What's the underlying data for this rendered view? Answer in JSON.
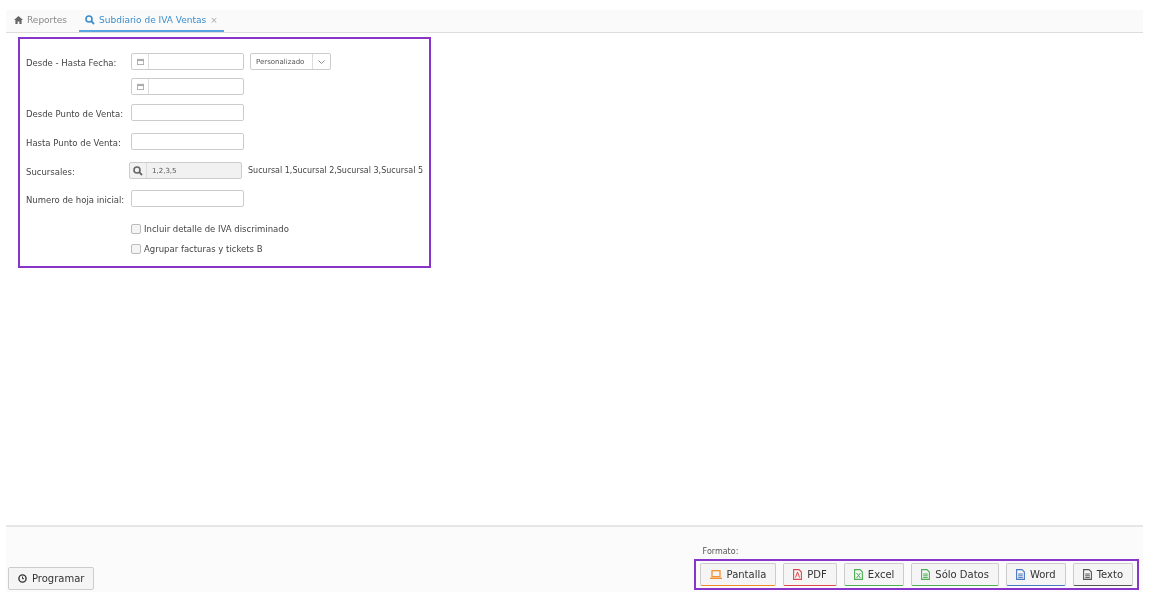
{
  "tabs": [
    {
      "label": "Reportes",
      "kind": "home",
      "selected": false
    },
    {
      "label": "Subdiario de IVA Ventas",
      "kind": "search",
      "selected": true,
      "close": "×"
    }
  ],
  "form": {
    "fields": [
      {
        "kind": "daterange",
        "label": "Desde - Hasta Fecha:",
        "period": "Personalizado"
      },
      {
        "kind": "text",
        "label": "Desde Punto de Venta:"
      },
      {
        "kind": "text",
        "label": "Hasta Punto de Venta:"
      },
      {
        "kind": "lookup",
        "label": "Sucursales:",
        "value": "1,2,3,5",
        "description": "Sucursal 1,Sucursal 2,Sucursal 3,Sucursal 5"
      },
      {
        "kind": "text",
        "label": "Numero de hoja inicial:"
      },
      {
        "kind": "checkbox",
        "label": "Incluir detalle de IVA discriminado",
        "checked": false
      },
      {
        "kind": "checkbox",
        "label": "Agrupar facturas y tickets B",
        "checked": false
      }
    ]
  },
  "footer": {
    "schedule_button": "Programar",
    "format_label": "Formato:",
    "formats": [
      {
        "label": "Pantalla",
        "kind": "screen",
        "color": "#f08a24"
      },
      {
        "label": "PDF",
        "kind": "pdf",
        "color": "#e0474c"
      },
      {
        "label": "Excel",
        "kind": "excel",
        "color": "#4caf50"
      },
      {
        "label": "Sólo Datos",
        "kind": "data",
        "color": "#4caf50"
      },
      {
        "label": "Word",
        "kind": "word",
        "color": "#4a78c2"
      },
      {
        "label": "Texto",
        "kind": "text",
        "color": "#555555"
      }
    ]
  }
}
